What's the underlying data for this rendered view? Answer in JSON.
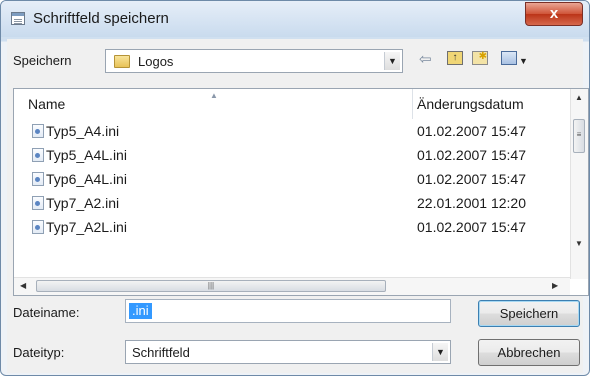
{
  "window": {
    "title": "Schriftfeld speichern",
    "close_label": "x"
  },
  "location": {
    "label": "Speichern",
    "folder": "Logos"
  },
  "toolbar": {
    "back_icon": "back-arrow-icon",
    "up_icon": "up-folder-icon",
    "new_folder_icon": "new-folder-icon",
    "view_icon": "view-menu-icon"
  },
  "list": {
    "columns": [
      "Name",
      "Änderungsdatum"
    ],
    "rows": [
      {
        "name": "Typ5_A4.ini",
        "date": "01.02.2007 15:47"
      },
      {
        "name": "Typ5_A4L.ini",
        "date": "01.02.2007 15:47"
      },
      {
        "name": "Typ6_A4L.ini",
        "date": "01.02.2007 15:47"
      },
      {
        "name": "Typ7_A2.ini",
        "date": "22.01.2001 12:20"
      },
      {
        "name": "Typ7_A2L.ini",
        "date": "01.02.2007 15:47"
      }
    ]
  },
  "filename": {
    "label": "Dateiname:",
    "value": ".ini"
  },
  "filetype": {
    "label": "Dateityp:",
    "value": "Schriftfeld"
  },
  "buttons": {
    "save": "Speichern",
    "cancel": "Abbrechen"
  },
  "colors": {
    "selection": "#3399ff",
    "close": "#c84a2f",
    "folder": "#e8c258"
  }
}
